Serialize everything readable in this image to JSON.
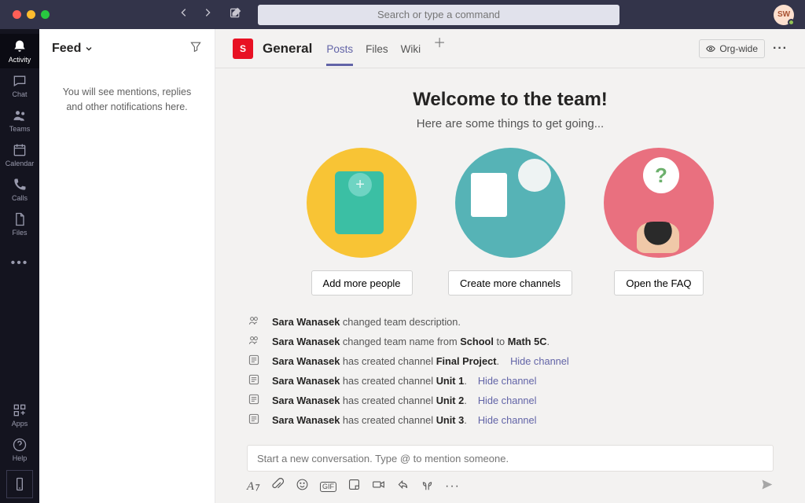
{
  "search": {
    "placeholder": "Search or type a command"
  },
  "avatar": {
    "initials": "SW"
  },
  "rail": {
    "items": [
      {
        "label": "Activity"
      },
      {
        "label": "Chat"
      },
      {
        "label": "Teams"
      },
      {
        "label": "Calendar"
      },
      {
        "label": "Calls"
      },
      {
        "label": "Files"
      }
    ],
    "apps": "Apps",
    "help": "Help"
  },
  "feed": {
    "title": "Feed",
    "empty": "You will see mentions, replies and other notifications here."
  },
  "channel": {
    "avatar_letter": "S",
    "name": "General",
    "tabs": [
      "Posts",
      "Files",
      "Wiki"
    ],
    "org_label": "Org-wide"
  },
  "welcome": {
    "heading": "Welcome to the team!",
    "sub": "Here are some things to get going...",
    "cards": [
      {
        "button": "Add more people"
      },
      {
        "button": "Create more channels"
      },
      {
        "button": "Open the FAQ"
      }
    ]
  },
  "events": [
    {
      "icon": "team",
      "user": "Sara Wanasek",
      "text": " changed team description."
    },
    {
      "icon": "team",
      "user": "Sara Wanasek",
      "text": " changed team name from ",
      "b1": "School",
      "mid": " to ",
      "b2": "Math 5C",
      "suffix": "."
    },
    {
      "icon": "channel",
      "user": "Sara Wanasek",
      "text": " has created channel ",
      "b1": "Final Project",
      "suffix": ". ",
      "link": "Hide channel"
    },
    {
      "icon": "channel",
      "user": "Sara Wanasek",
      "text": " has created channel ",
      "b1": "Unit 1",
      "suffix": ". ",
      "link": "Hide channel"
    },
    {
      "icon": "channel",
      "user": "Sara Wanasek",
      "text": " has created channel ",
      "b1": "Unit 2",
      "suffix": ". ",
      "link": "Hide channel"
    },
    {
      "icon": "channel",
      "user": "Sara Wanasek",
      "text": " has created channel ",
      "b1": "Unit 3",
      "suffix": ". ",
      "link": "Hide channel"
    }
  ],
  "composer": {
    "placeholder": "Start a new conversation. Type @ to mention someone."
  }
}
